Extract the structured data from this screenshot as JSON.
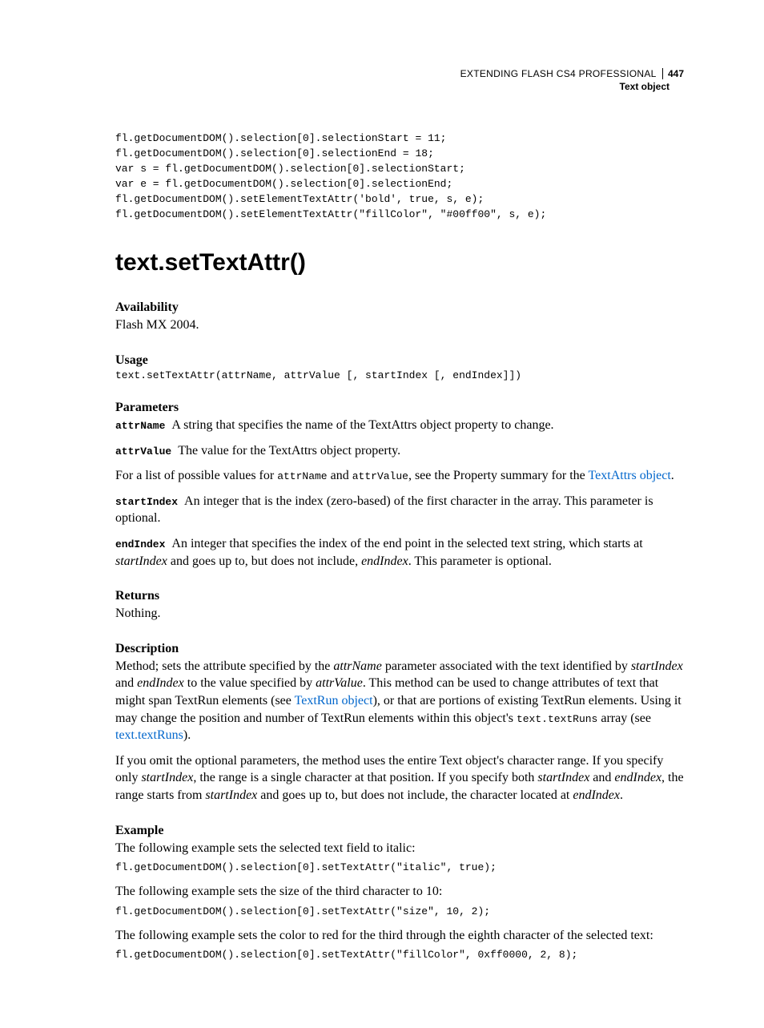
{
  "header": {
    "book_title": "EXTENDING FLASH CS4 PROFESSIONAL",
    "page_number": "447",
    "section": "Text object"
  },
  "intro_code": "fl.getDocumentDOM().selection[0].selectionStart = 11;\nfl.getDocumentDOM().selection[0].selectionEnd = 18;\nvar s = fl.getDocumentDOM().selection[0].selectionStart;\nvar e = fl.getDocumentDOM().selection[0].selectionEnd;\nfl.getDocumentDOM().setElementTextAttr('bold', true, s, e);\nfl.getDocumentDOM().setElementTextAttr(\"fillColor\", \"#00ff00\", s, e);",
  "entry_title": "text.setTextAttr()",
  "labels": {
    "availability": "Availability",
    "usage": "Usage",
    "parameters": "Parameters",
    "returns": "Returns",
    "description": "Description",
    "example": "Example"
  },
  "availability": {
    "text": "Flash MX 2004."
  },
  "usage": {
    "code": "text.setTextAttr(attrName, attrValue [, startIndex [, endIndex]])"
  },
  "parameters": {
    "attrName": {
      "name": "attrName",
      "desc": "A string that specifies the name of the TextAttrs object property to change."
    },
    "attrValue": {
      "name": "attrValue",
      "desc": "The value for the TextAttrs object property."
    },
    "listnote": {
      "pre": "For a list of possible values for ",
      "attrName": "attrName",
      "mid": " and ",
      "attrValue": "attrValue",
      "post1": ", see the Property summary for the ",
      "link": "TextAttrs object",
      "post2": "."
    },
    "startIndex": {
      "name": "startIndex",
      "desc": "An integer that is the index (zero-based) of the first character in the array. This parameter is optional."
    },
    "endIndex": {
      "name": "endIndex",
      "desc_pre": "An integer that specifies the index of the end point in the selected text string, which starts at ",
      "desc_em1": "startIndex",
      "desc_mid": " and goes up to, but does not include, ",
      "desc_em2": "endIndex",
      "desc_post": ". This parameter is optional."
    }
  },
  "returns": {
    "text": "Nothing."
  },
  "description": {
    "p1": {
      "t1": "Method; sets the attribute specified by the ",
      "em1": "attrName",
      "t2": " parameter associated with the text identified by ",
      "em2": "startIndex",
      "t3": " and ",
      "em3": "endIndex",
      "t4": " to the value specified by ",
      "em4": "attrValue",
      "t5": ". This method can be used to change attributes of text that might span TextRun elements (see ",
      "link1": "TextRun object",
      "t6": "), or that are portions of existing TextRun elements. Using it may change the position and number of TextRun elements within this object's ",
      "mono": "text.textRuns",
      "t7": " array (see ",
      "link2": "text.textRuns",
      "t8": ")."
    },
    "p2": {
      "t1": "If you omit the optional parameters, the method uses the entire Text object's character range. If you specify only ",
      "em1": "startIndex",
      "t2": ", the range is a single character at that position. If you specify both ",
      "em2": "startIndex",
      "t3": " and ",
      "em3": "endIndex",
      "t4": ", the range starts from ",
      "em4": "startIndex",
      "t5": " and goes up to, but does not include, the character located at ",
      "em5": "endIndex",
      "t6": "."
    }
  },
  "example": {
    "line1": "The following example sets the selected text field to italic:",
    "code1": "fl.getDocumentDOM().selection[0].setTextAttr(\"italic\", true);",
    "line2": "The following example sets the size of the third character to 10:",
    "code2": "fl.getDocumentDOM().selection[0].setTextAttr(\"size\", 10, 2);",
    "line3": "The following example sets the color to red for the third through the eighth character of the selected text:",
    "code3": "fl.getDocumentDOM().selection[0].setTextAttr(\"fillColor\", 0xff0000, 2, 8);"
  }
}
